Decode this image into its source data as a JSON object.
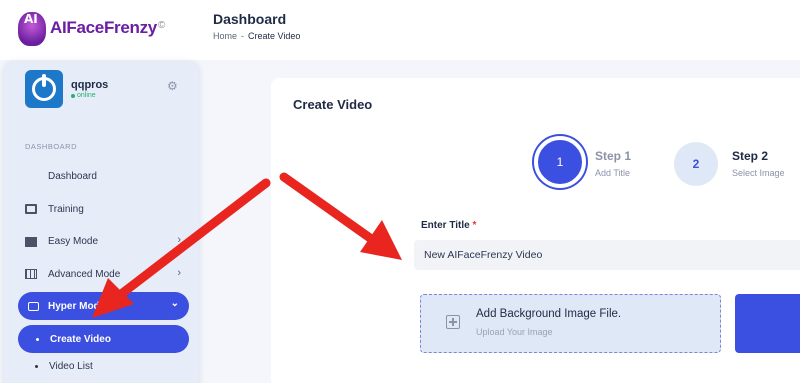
{
  "brand": {
    "badge_text": "AI",
    "name": "AIFaceFrenzy",
    "reg_mark": "©"
  },
  "header": {
    "title": "Dashboard",
    "breadcrumb": {
      "home": "Home",
      "separator": "-",
      "current": "Create Video"
    }
  },
  "user": {
    "name": "qqpros",
    "status": "online"
  },
  "sidebar": {
    "section_label": "DASHBOARD",
    "items": [
      {
        "label": "Dashboard",
        "icon": "grid-icon"
      },
      {
        "label": "Training",
        "icon": "monitor-icon"
      },
      {
        "label": "Easy Mode",
        "icon": "easy-mode-icon",
        "has_chevron": true
      },
      {
        "label": "Advanced Mode",
        "icon": "table-icon",
        "has_chevron": true
      }
    ],
    "hyper_mode": {
      "label": "Hyper Mode",
      "icon": "message-icon",
      "expanded": true
    },
    "sub_items": [
      {
        "label": "Create Video",
        "active": true
      },
      {
        "label": "Video List",
        "active": false
      }
    ]
  },
  "main": {
    "card_title": "Create Video",
    "steps": [
      {
        "number": "1",
        "title": "Step 1",
        "subtitle": "Add Title",
        "active": true
      },
      {
        "number": "2",
        "title": "Step 2",
        "subtitle": "Select Image",
        "active": false
      }
    ],
    "title_field": {
      "label": "Enter Title",
      "required_mark": "*",
      "value": "New AIFaceFrenzy Video"
    },
    "upload": {
      "title": "Add Background Image File.",
      "subtitle": "Upload Your Image"
    }
  },
  "colors": {
    "accent": "#3b4fe0",
    "brand_purple": "#6b1ea3",
    "annotation_arrow": "#e8261f",
    "online": "#27b06a"
  }
}
